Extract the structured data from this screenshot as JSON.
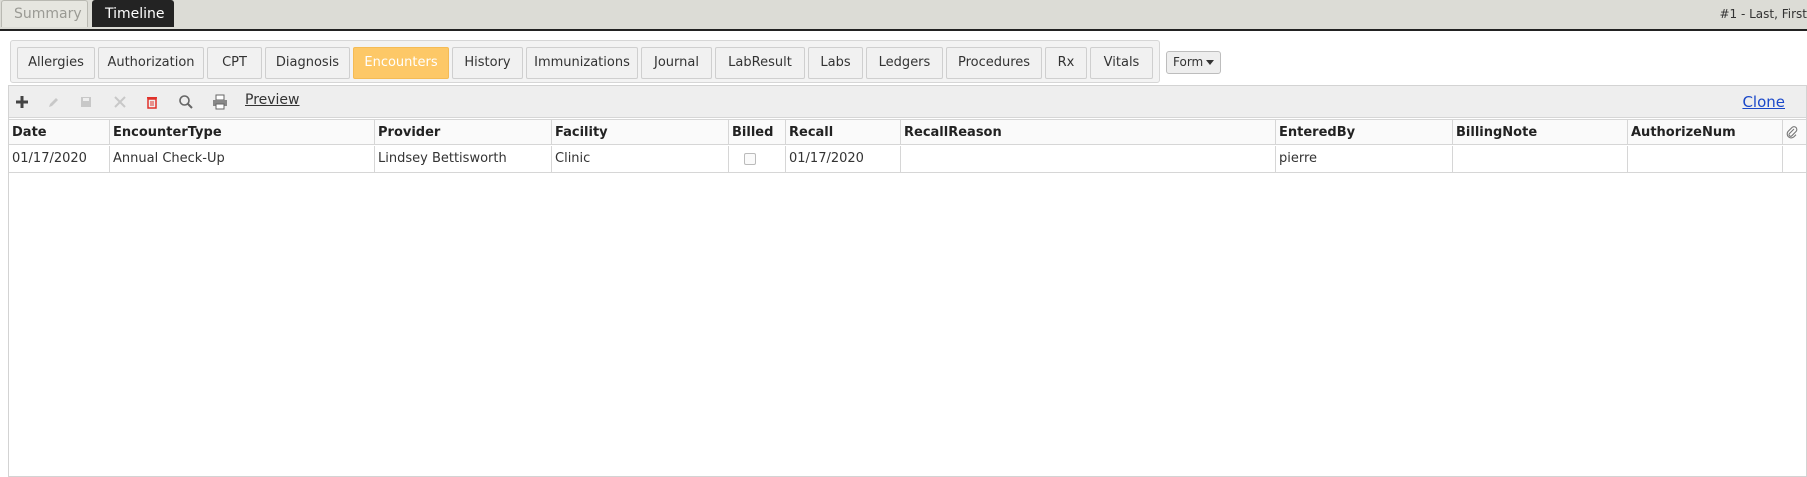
{
  "top_tabs": {
    "summary": "Summary",
    "timeline": "Timeline"
  },
  "patient_label": "#1 - Last, First",
  "sub_tabs": [
    {
      "label": "Allergies"
    },
    {
      "label": "Authorization"
    },
    {
      "label": "CPT"
    },
    {
      "label": "Diagnosis"
    },
    {
      "label": "Encounters"
    },
    {
      "label": "History"
    },
    {
      "label": "Immunizations"
    },
    {
      "label": "Journal"
    },
    {
      "label": "LabResult"
    },
    {
      "label": "Labs"
    },
    {
      "label": "Ledgers"
    },
    {
      "label": "Procedures"
    },
    {
      "label": "Rx"
    },
    {
      "label": "Vitals"
    }
  ],
  "active_sub_tab": "Encounters",
  "form_button": "Form",
  "toolbar": {
    "icons": [
      "plus-icon",
      "pencil-icon",
      "save-icon",
      "cancel-icon",
      "trash-icon",
      "search-icon",
      "print-icon"
    ],
    "preview_label": "Preview",
    "clone_label": "Clone"
  },
  "grid": {
    "columns": [
      "Date",
      "EncounterType",
      "Provider",
      "Facility",
      "Billed",
      "Recall",
      "RecallReason",
      "EnteredBy",
      "BillingNote",
      "AuthorizeNum"
    ],
    "attachment_icon": "paperclip-icon",
    "rows": [
      {
        "Date": "01/17/2020",
        "EncounterType": "Annual Check-Up",
        "Provider": "Lindsey Bettisworth",
        "Facility": "Clinic",
        "Billed": false,
        "Recall": "01/17/2020",
        "RecallReason": "",
        "EnteredBy": "pierre",
        "BillingNote": "",
        "AuthorizeNum": ""
      }
    ]
  },
  "colors": {
    "active_tab": "#fdc867",
    "top_active": "#232323",
    "link": "#1a48c9",
    "delete": "#e0312a"
  }
}
